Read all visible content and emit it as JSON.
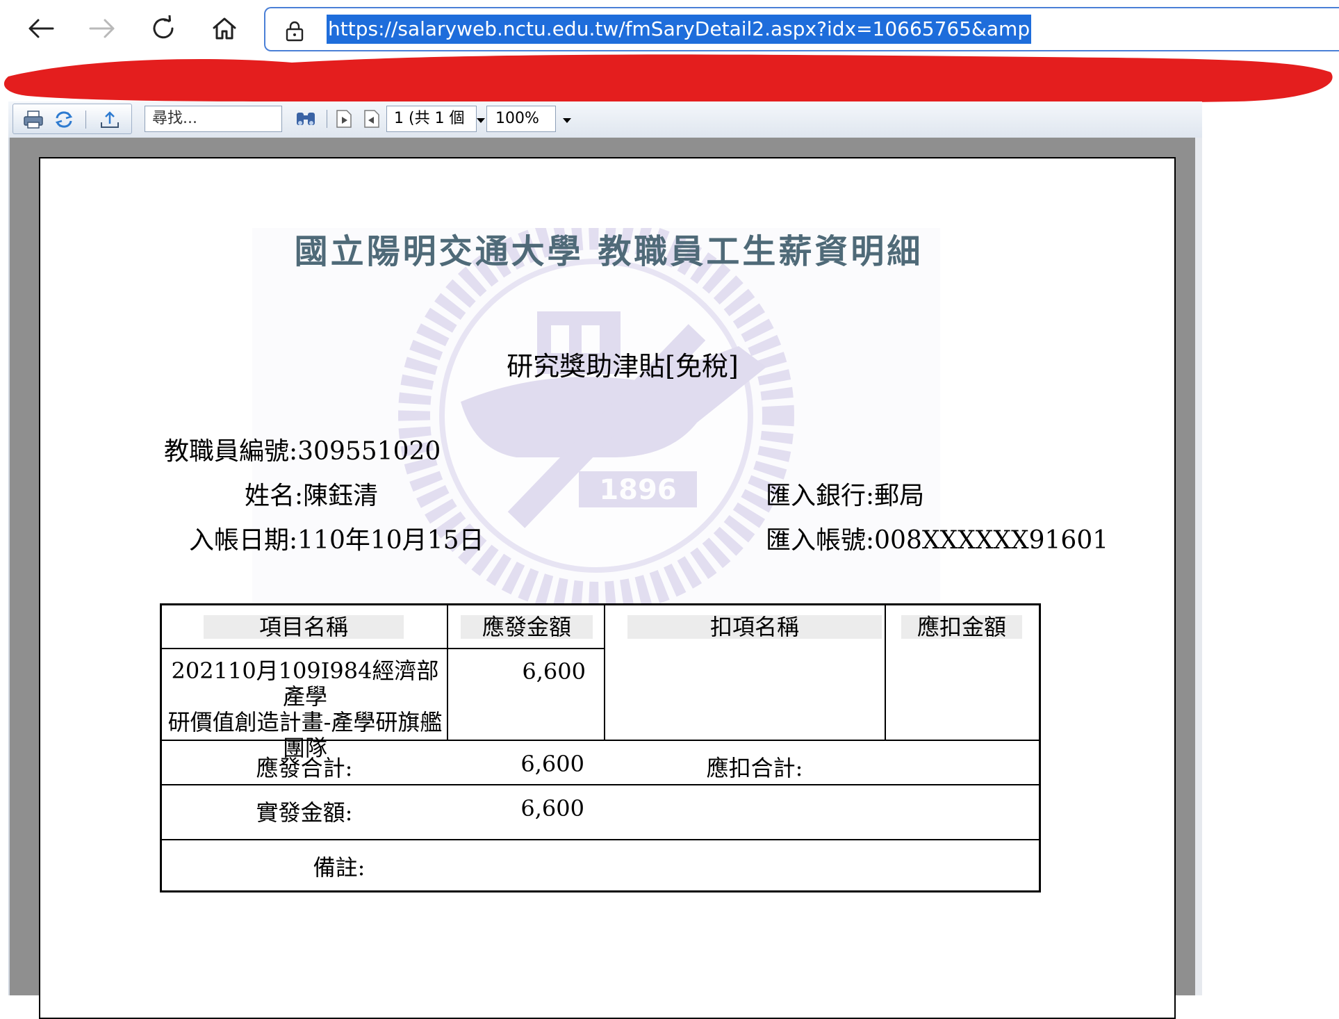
{
  "browser": {
    "url": "https://salaryweb.nctu.edu.tw/fmSaryDetail2.aspx?idx=10665765&amp"
  },
  "viewer": {
    "find_placeholder": "尋找...",
    "page_indicator": "1 (共 1 個",
    "zoom": "100%"
  },
  "report": {
    "title": "國立陽明交通大學  教職員工生薪資明細",
    "subtitle": "研究獎助津貼[免稅]",
    "watermark_year": "1896",
    "fields": {
      "employee_id_label": "教職員編號:",
      "employee_id": "309551020",
      "name_label": "姓名:",
      "name": "陳鈺清",
      "date_label": "入帳日期:",
      "date": "110年10月15日",
      "bank_label": "匯入銀行:",
      "bank": "郵局",
      "account_label": "匯入帳號:",
      "account": "008XXXXXX91601"
    },
    "table": {
      "headers": [
        "項目名稱",
        "應發金額",
        "扣項名稱",
        "應扣金額"
      ],
      "rows": [
        {
          "item_lines": [
            "202110月109I984經濟部產學",
            "研價值創造計畫-產學研旗艦",
            "團隊"
          ],
          "amount": "6,600",
          "deduct_item": "",
          "deduct_amount": ""
        }
      ],
      "total_pay_label": "應發合計:",
      "total_pay": "6,600",
      "total_deduct_label": "應扣合計:",
      "total_deduct": "",
      "net_pay_label": "實發金額:",
      "net_pay": "6,600",
      "remarks_label": "備註:",
      "remarks": ""
    }
  },
  "colors": {
    "url_highlight": "#1e6ddb",
    "redaction": "#e41e1e",
    "title": "#4f6a78",
    "watermark": "#cfc8e6"
  }
}
